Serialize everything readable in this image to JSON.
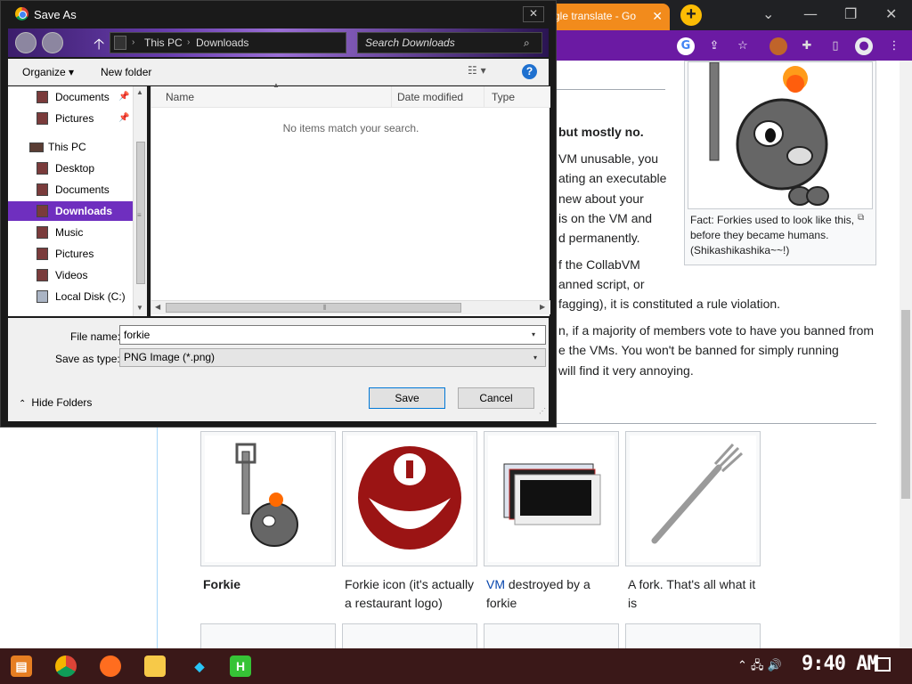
{
  "browser": {
    "tab_title": "gle translate - Go",
    "tab_close": "✕",
    "new_tab": "+",
    "window_controls": {
      "collapse": "⌄",
      "minimize": "—",
      "restore": "❐",
      "close": "✕"
    },
    "toolbar_icons": [
      "google-icon",
      "share-icon",
      "star-icon",
      "avatar-forkie",
      "extensions-icon",
      "sidebar-icon",
      "profile-icon",
      "menu-icon"
    ],
    "toolbar_glyphs": {
      "google": "G",
      "share": "⇪",
      "star": "☆",
      "extensions": "✚",
      "sidebar": "▯",
      "profile": "●",
      "menu": "⋮"
    }
  },
  "page": {
    "lines": [
      "but mostly no.",
      "VM unusable, you",
      "ating an executable",
      "new about your",
      "is on the VM and",
      "d permanently.",
      "f the CollabVM",
      "anned script, or",
      "fagging), it is constituted a rule violation.",
      "n, if a majority of members vote to have you banned from",
      "e the VMs. You won't be banned for simply running",
      "will find it very annoying."
    ],
    "thumb_caption": "Fact: Forkies used to look like this, before they became humans. (Shikashikashika~~!)",
    "thumb_magnify": "⧉",
    "gallery": [
      {
        "caption": "Forkie",
        "caption_link": "",
        "caption_rest": ""
      },
      {
        "caption": "Forkie icon (it's actually a restaurant logo)",
        "caption_link": "",
        "caption_rest": ""
      },
      {
        "caption": "",
        "caption_link": "VM",
        "caption_rest": " destroyed by a forkie"
      },
      {
        "caption": "A fork. That's all what it is",
        "caption_link": "",
        "caption_rest": ""
      }
    ]
  },
  "dialog": {
    "title": "Save As",
    "close": "✕",
    "nav": {
      "back": "",
      "forward": "",
      "up": "🡡",
      "sep": "›",
      "breadcrumb": [
        "This PC",
        "Downloads"
      ],
      "search_placeholder": "Search Downloads",
      "search_icon": "⌕"
    },
    "commands": {
      "organize": "Organize ▾",
      "new_folder": "New folder",
      "view": "☷ ▾",
      "help": "?"
    },
    "navpane": {
      "items": [
        {
          "label": "Documents",
          "pinned": true,
          "type": "quick"
        },
        {
          "label": "Pictures",
          "pinned": true,
          "type": "quick"
        },
        {
          "label": "This PC",
          "pinned": false,
          "type": "thispc"
        },
        {
          "label": "Desktop",
          "pinned": false,
          "type": "child"
        },
        {
          "label": "Documents",
          "pinned": false,
          "type": "child"
        },
        {
          "label": "Downloads",
          "pinned": false,
          "type": "child",
          "selected": true
        },
        {
          "label": "Music",
          "pinned": false,
          "type": "child"
        },
        {
          "label": "Pictures",
          "pinned": false,
          "type": "child"
        },
        {
          "label": "Videos",
          "pinned": false,
          "type": "child"
        },
        {
          "label": "Local Disk (C:)",
          "pinned": false,
          "type": "child"
        }
      ],
      "pin_glyph": "📌"
    },
    "filelist": {
      "columns": [
        "Name",
        "Date modified",
        "Type"
      ],
      "empty_message": "No items match your search.",
      "sort_glyph": "▲"
    },
    "scroll_glyphs": {
      "up": "▲",
      "down": "▼",
      "left": "◀",
      "right": "▶",
      "grip": "≡",
      "hgrip": "⦀"
    },
    "file_name_label": "File name:",
    "file_name_value": "forkie",
    "save_type_label": "Save as type:",
    "save_type_value": "PNG Image (*.png)",
    "dropdown_glyph": "▾",
    "hide_folders": "Hide Folders",
    "hide_folders_glyph": "⌃",
    "save": "Save",
    "cancel": "Cancel",
    "resize_glyph": "⋰"
  },
  "taskbar": {
    "apps": [
      "start-icon",
      "chrome-icon",
      "firefox-icon",
      "file-explorer-icon",
      "diamond-app-icon",
      "h-app-icon"
    ],
    "tray": "⌃  🖧  🔊",
    "clock": "9:40 AM"
  }
}
